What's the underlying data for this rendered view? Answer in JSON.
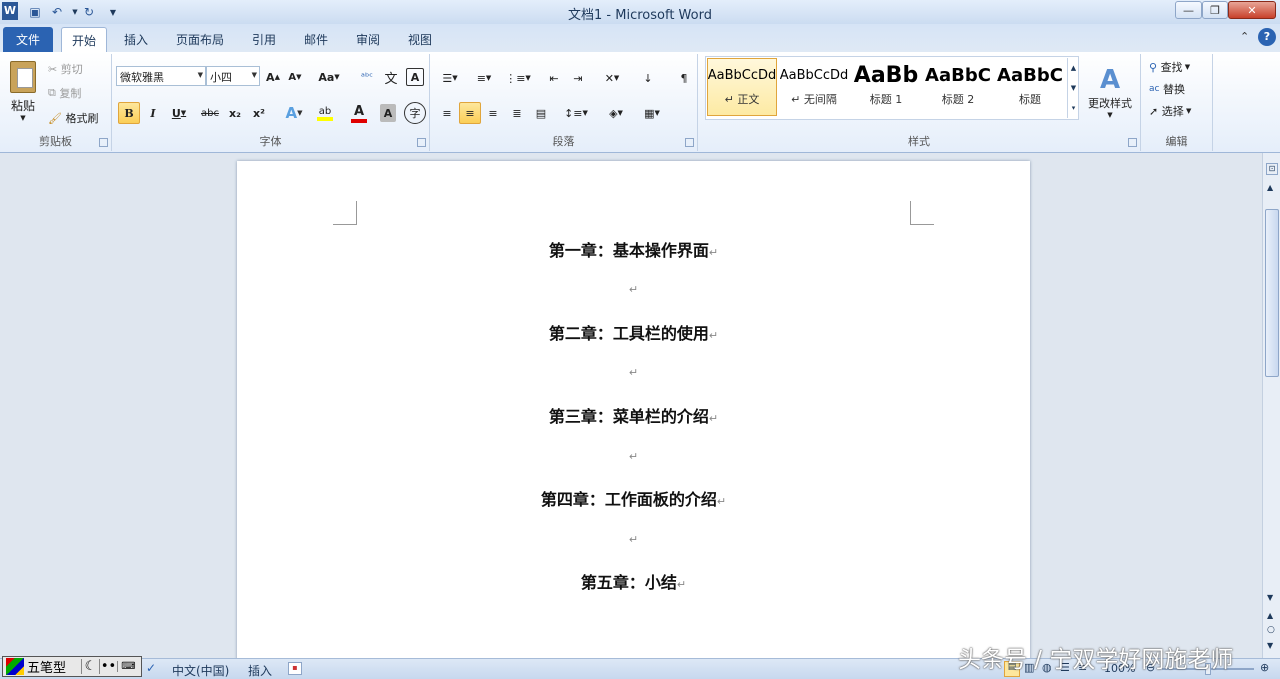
{
  "window": {
    "title": "文档1  -  Microsoft Word"
  },
  "tabs": [
    {
      "label": "文件"
    },
    {
      "label": "开始"
    },
    {
      "label": "插入"
    },
    {
      "label": "页面布局"
    },
    {
      "label": "引用"
    },
    {
      "label": "邮件"
    },
    {
      "label": "审阅"
    },
    {
      "label": "视图"
    }
  ],
  "clipboard": {
    "paste": "粘贴",
    "cut": "剪切",
    "copy": "复制",
    "format_painter": "格式刷",
    "label": "剪贴板"
  },
  "font": {
    "name": "微软雅黑",
    "size": "小四",
    "label": "字体",
    "case": "Aa",
    "bold": "B",
    "italic": "I",
    "underline": "U",
    "strike": "abc",
    "sub": "x₂",
    "sup": "x²"
  },
  "paragraph": {
    "label": "段落"
  },
  "styles": {
    "label": "样式",
    "items": [
      {
        "sample": "AaBbCcDd",
        "name": "↵ 正文"
      },
      {
        "sample": "AaBbCcDd",
        "name": "↵ 无间隔"
      },
      {
        "sample": "AaBb",
        "name": "标题 1"
      },
      {
        "sample": "AaBbC",
        "name": "标题 2"
      },
      {
        "sample": "AaBbC",
        "name": "标题"
      }
    ],
    "change": "更改样式"
  },
  "editing": {
    "find": "查找",
    "replace": "替换",
    "select": "选择",
    "label": "编辑"
  },
  "document": {
    "headings": [
      "第一章：基本操作界面",
      "第二章：工具栏的使用",
      "第三章：菜单栏的介绍",
      "第四章：工作面板的介绍",
      "第五章：小结"
    ],
    "paragraph_mark": "↵"
  },
  "statusbar": {
    "language": "中文(中国)",
    "mode": "插入",
    "zoom": "100%"
  },
  "ime": {
    "name": "五笔型"
  },
  "watermark": "头条号 / 宁双学好网施老师"
}
